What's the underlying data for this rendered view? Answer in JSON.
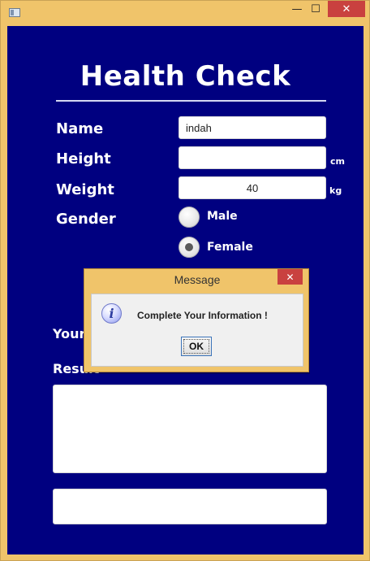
{
  "window": {
    "icon": "app-icon",
    "controls": {
      "minimize": "—",
      "maximize": "☐",
      "close": "✕"
    }
  },
  "form": {
    "title": "Health Check",
    "labels": {
      "name": "Name",
      "height": "Height",
      "weight": "Weight",
      "gender": "Gender",
      "your_partial": "Your",
      "result_partial": "Result"
    },
    "fields": {
      "name_value": "indah",
      "height_value": "",
      "weight_value": "40"
    },
    "units": {
      "height": "cm",
      "weight": "kg"
    },
    "gender_options": [
      {
        "label": "Male",
        "selected": false
      },
      {
        "label": "Female",
        "selected": true
      }
    ]
  },
  "dialog": {
    "title": "Message",
    "message": "Complete Your Information !",
    "ok_label": "OK",
    "close": "✕",
    "icon": "info-icon"
  },
  "colors": {
    "frame": "#f0c46a",
    "panel": "#000080",
    "close": "#c9413f",
    "dialog_body": "#f0f0f0"
  }
}
